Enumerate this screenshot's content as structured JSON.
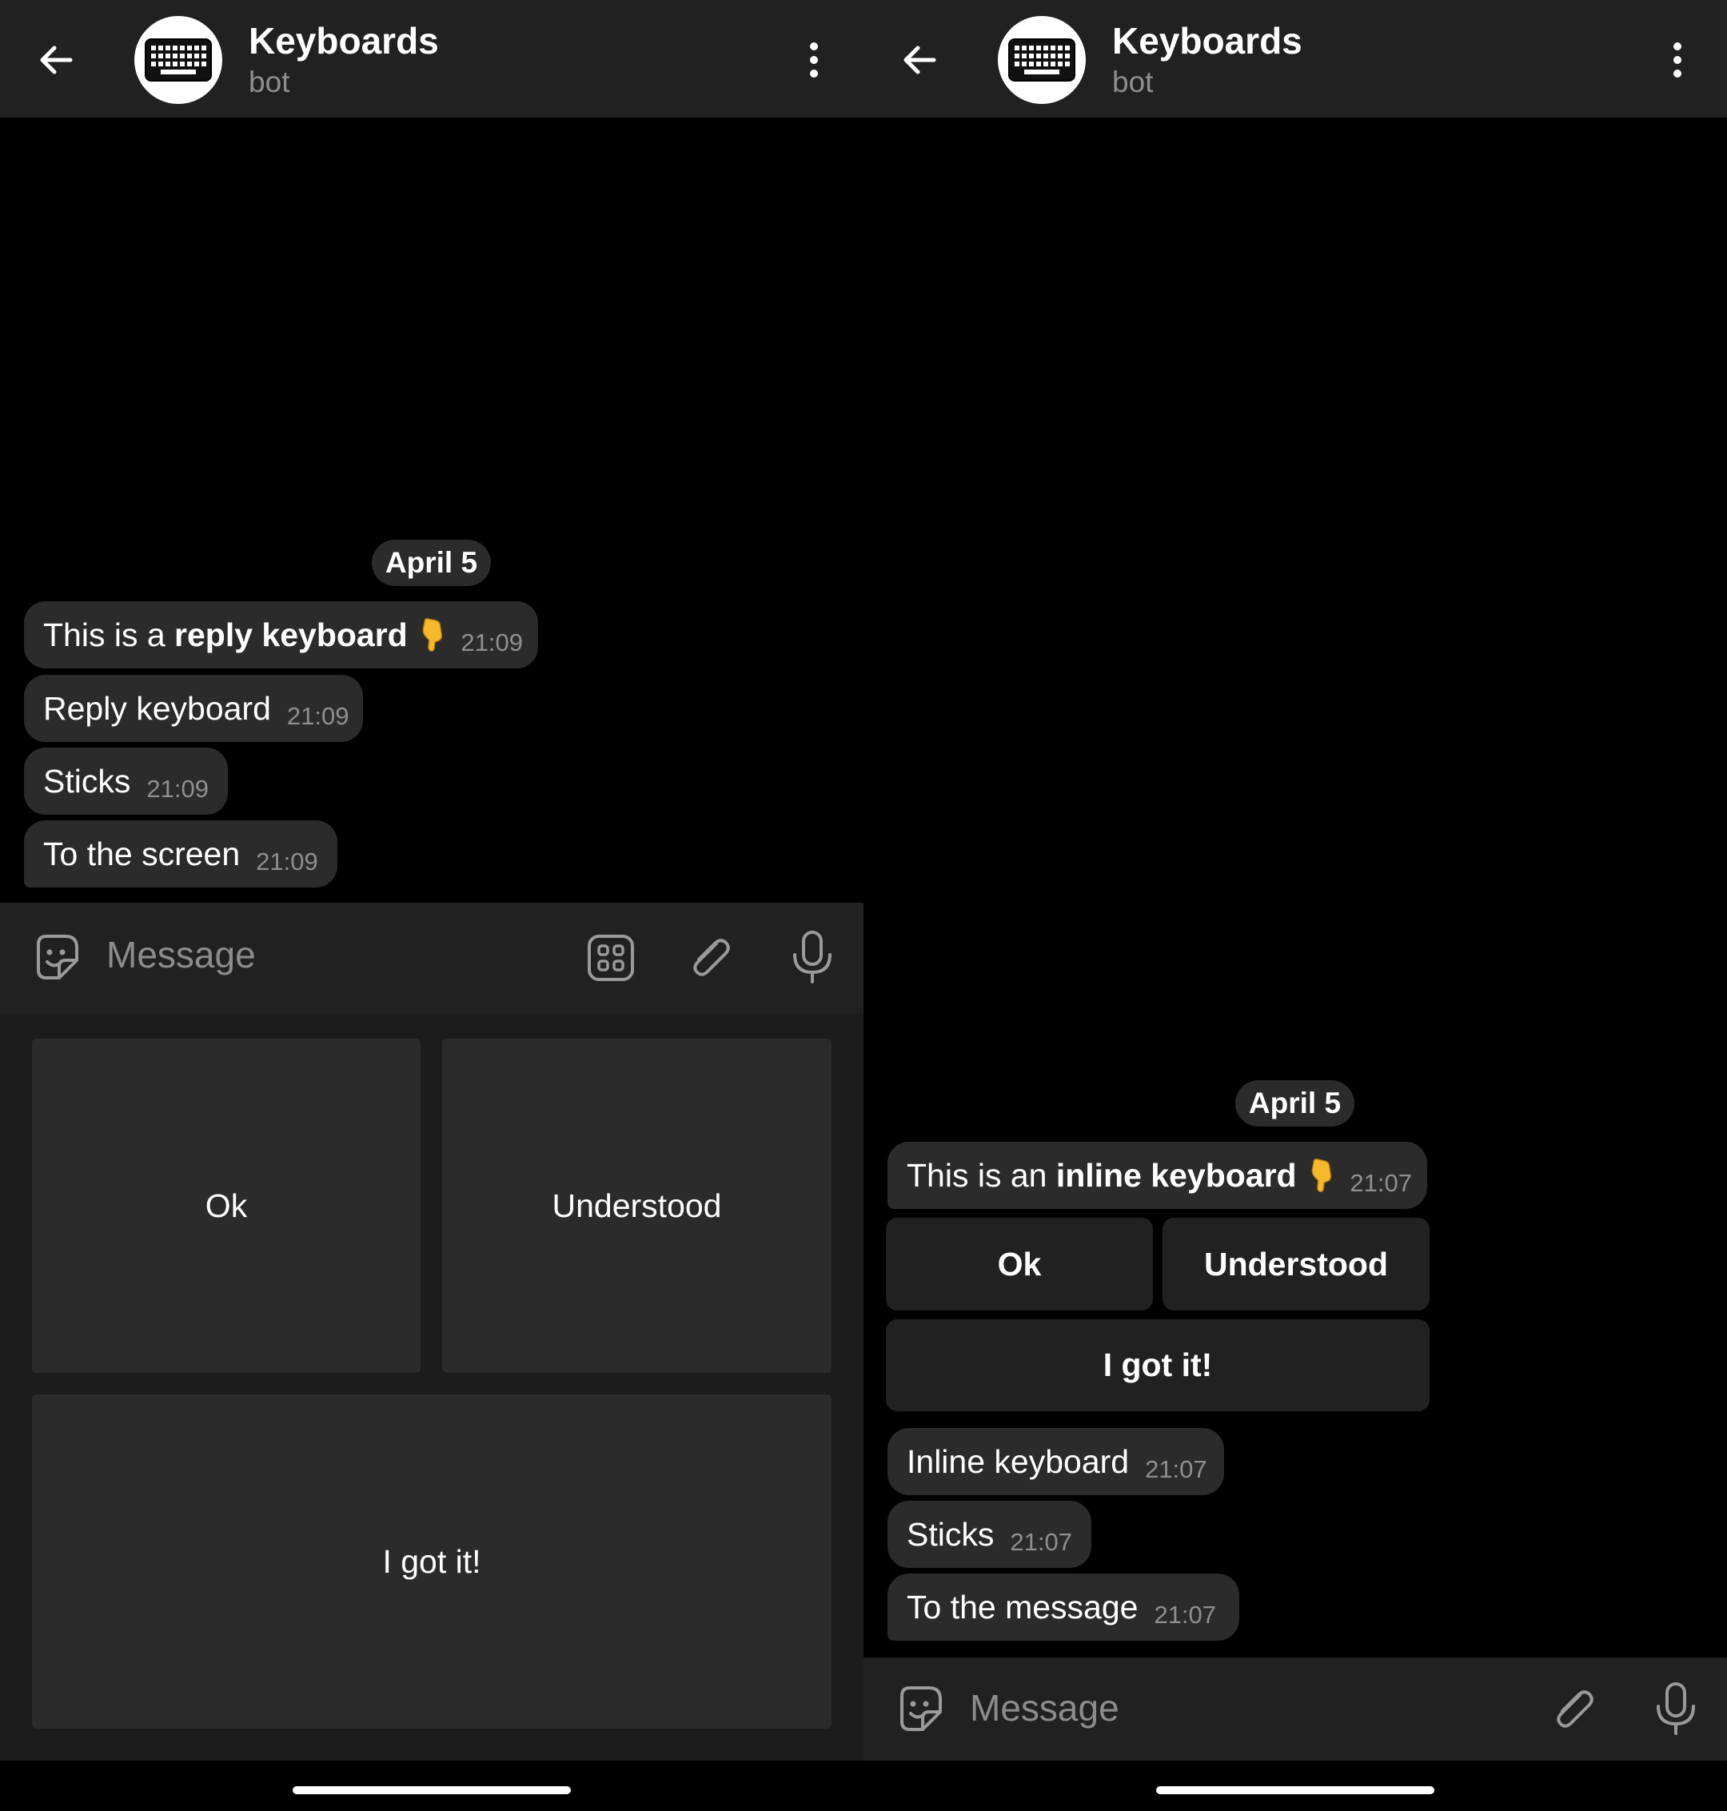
{
  "left": {
    "header": {
      "title": "Keyboards",
      "subtitle": "bot"
    },
    "date_chip": "April 5",
    "messages": [
      {
        "text_pre": "This is a ",
        "text_bold": "reply keyboard",
        "time": "21:09"
      },
      {
        "text": "Reply keyboard",
        "time": "21:09"
      },
      {
        "text": "Sticks",
        "time": "21:09"
      },
      {
        "text": "To the screen",
        "time": "21:09"
      }
    ],
    "input": {
      "placeholder": "Message"
    },
    "reply_keyboard": {
      "buttons": [
        "Ok",
        "Understood",
        "I got it!"
      ]
    }
  },
  "right": {
    "header": {
      "title": "Keyboards",
      "subtitle": "bot"
    },
    "date_chip": "April 5",
    "messages": [
      {
        "text_pre": "This is an ",
        "text_bold": "inline keyboard",
        "time": "21:07"
      },
      {
        "text": "Inline keyboard",
        "time": "21:07"
      },
      {
        "text": "Sticks",
        "time": "21:07"
      },
      {
        "text": "To the message",
        "time": "21:07"
      }
    ],
    "inline_keyboard": {
      "buttons": [
        "Ok",
        "Understood",
        "I got it!"
      ]
    },
    "input": {
      "placeholder": "Message"
    }
  },
  "icons": {
    "back": "arrow-left-icon",
    "avatar": "keyboard-icon",
    "menu": "more-vertical-icon",
    "emoji": "pointing-down-hand-emoji",
    "sticker": "sticker-smile-icon",
    "bot_keyboard": "keyboard-grid-icon",
    "attach": "paperclip-icon",
    "mic": "microphone-icon"
  },
  "colors": {
    "background": "#000000",
    "header": "#212121",
    "bubble": "#2b2b2b",
    "keyboard_area": "#1c1c1c",
    "secondary_text": "#8f8f8f"
  }
}
